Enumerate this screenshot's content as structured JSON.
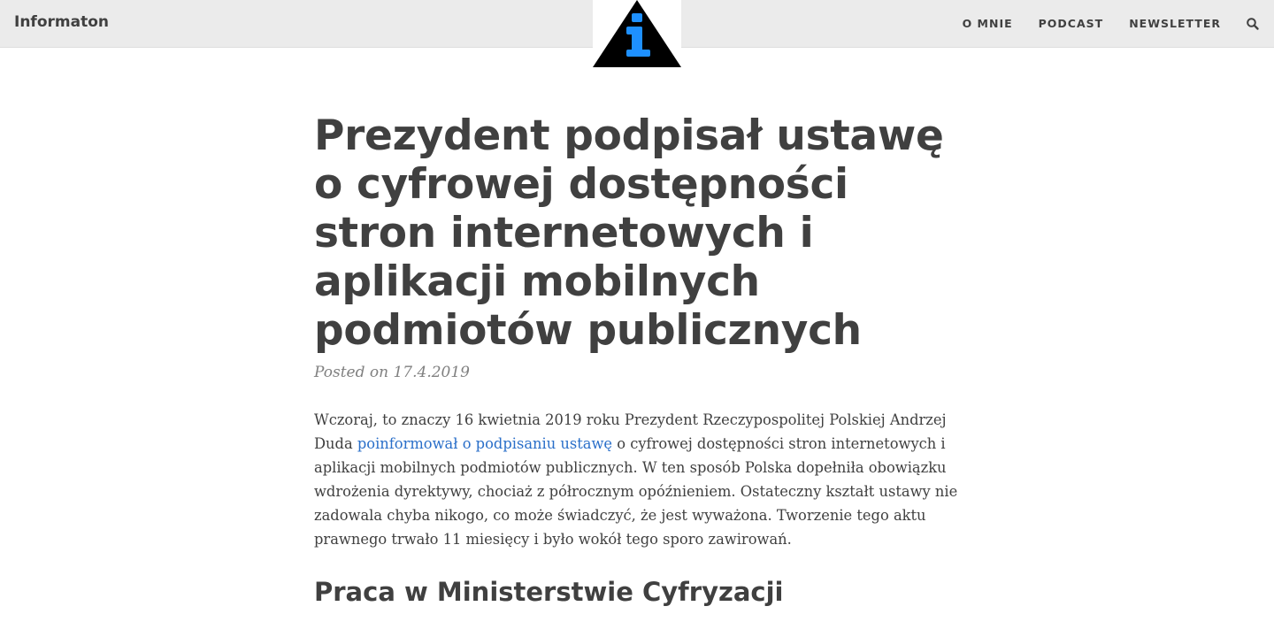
{
  "navbar": {
    "brand": "Informaton",
    "links": [
      "O MNIE",
      "PODCAST",
      "NEWSLETTER"
    ],
    "search_icon": "search-icon"
  },
  "logo": {
    "icon": "info-triangle-icon",
    "colors": {
      "triangle": "#000000",
      "glyph": "#1e90ff"
    }
  },
  "article": {
    "title": "Prezydent podpisał ustawę o cyfrowej dostępności stron internetowych i aplikacji mobilnych podmiotów publicznych",
    "meta": "Posted on 17.4.2019",
    "intro_before": "Wczoraj, to znaczy 16 kwietnia 2019 roku Prezydent Rzeczypospolitej Polskiej Andrzej Duda ",
    "intro_link": "poinformował o podpisaniu ustawę",
    "intro_after": " o cyfrowej dostępności stron internetowych i aplikacji mobilnych podmiotów publicznych. W ten sposób Polska dopełniła obowiązku wdrożenia dyrektywy, chociaż z półrocznym opóźnieniem. Ostateczny kształt ustawy nie zadowala chyba nikogo, co może świadczyć, że jest wyważona. Tworzenie tego aktu prawnego trwało 11 miesięcy i było wokół tego sporo zawirowań.",
    "section_heading": "Praca w Ministerstwie Cyfryzacji"
  },
  "colors": {
    "text": "#404040",
    "navbar_bg": "#ebebeb",
    "link": "#2a6fc9",
    "meta": "#808080"
  }
}
